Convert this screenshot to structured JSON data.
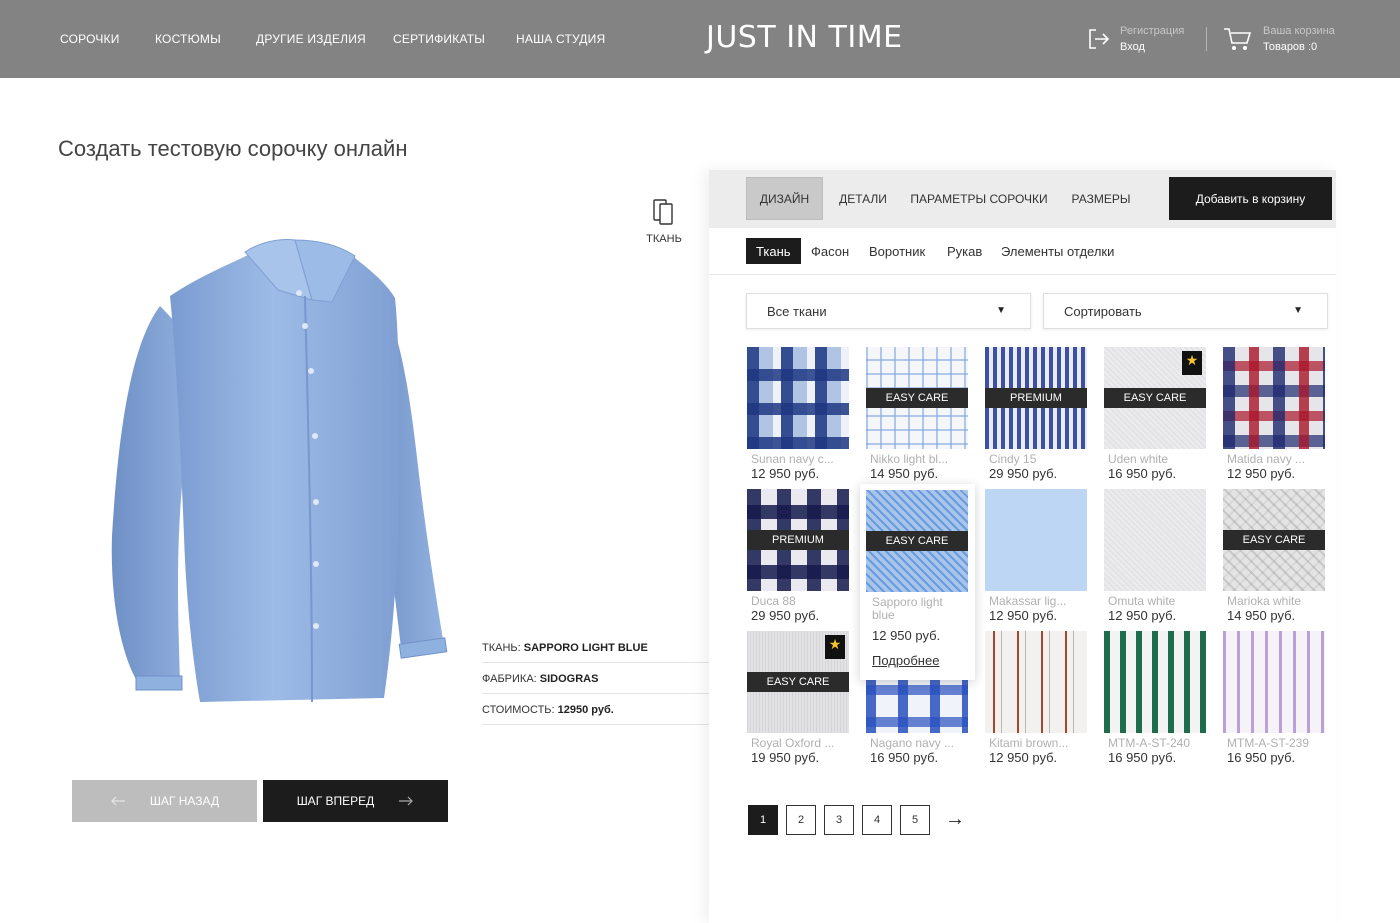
{
  "header": {
    "nav": [
      "СОРОЧКИ",
      "КОСТЮМЫ",
      "ДРУГИЕ ИЗДЕЛИЯ",
      "СЕРТИФИКАТЫ",
      "НАША СТУДИЯ"
    ],
    "logo": "JUST IN TIME",
    "register_label": "Регистрация",
    "login_label": "Вход",
    "cart_label": "Ваша корзина",
    "cart_count": "Товаров :0",
    "login_icon": "login-icon",
    "cart_icon": "cart-icon"
  },
  "page_title": "Создать тестовую сорочку онлайн",
  "fabric_control": {
    "label": "ТКАНЬ",
    "icon": "fabric-swatch-icon"
  },
  "info": {
    "fabric_label": "ТКАНЬ: ",
    "fabric_value": "SAPPORO LIGHT BLUE",
    "factory_label": "ФАБРИКА: ",
    "factory_value": "SIDOGRAS",
    "price_label": "СТОИМОСТЬ: ",
    "price_value": "12950 руб."
  },
  "steps": {
    "back": "ШАГ НАЗАД",
    "forward": "ШАГ ВПЕРЕД"
  },
  "tabs": {
    "items": [
      "ДИЗАЙН",
      "ДЕТАЛИ",
      "ПАРАМЕТРЫ СОРОЧКИ",
      "РАЗМЕРЫ"
    ],
    "active": "ДИЗАЙН",
    "add_to_cart": "Добавить в корзину"
  },
  "subtabs": {
    "items": [
      "Ткань",
      "Фасон",
      "Воротник",
      "Рукав",
      "Элементы отделки"
    ],
    "active": "Ткань"
  },
  "filters": {
    "fabrics": "Все ткани",
    "sort": "Сортировать"
  },
  "fabrics": [
    {
      "name": "Sunan navy c...",
      "price": "12 950 руб.",
      "badge": "",
      "star": false,
      "pattern": "check-navy"
    },
    {
      "name": "Nikko light bl...",
      "price": "14 950 руб.",
      "badge": "EASY CARE",
      "star": false,
      "pattern": "check-light"
    },
    {
      "name": "Cindy 15",
      "price": "29 950 руб.",
      "badge": "PREMIUM",
      "star": false,
      "pattern": "stripe-navy"
    },
    {
      "name": "Uden white",
      "price": "16 950 руб.",
      "badge": "EASY CARE",
      "star": true,
      "pattern": "white"
    },
    {
      "name": "Matida navy ...",
      "price": "12 950 руб.",
      "badge": "",
      "star": false,
      "pattern": "check-red"
    },
    {
      "name": "Duca 88",
      "price": "29 950 руб.",
      "badge": "PREMIUM",
      "star": false,
      "pattern": "check-dark"
    },
    {
      "name": "Sapporo light blue",
      "price": "12 950 руб.",
      "badge": "EASY CARE",
      "star": false,
      "pattern": "diag-blue"
    },
    {
      "name": "Makassar lig...",
      "price": "12 950 руб.",
      "badge": "",
      "star": false,
      "pattern": "plain-blue"
    },
    {
      "name": "Omuta white",
      "price": "12 950 руб.",
      "badge": "",
      "star": false,
      "pattern": "white"
    },
    {
      "name": "Marioka white",
      "price": "14 950 руб.",
      "badge": "EASY CARE",
      "star": false,
      "pattern": "herringbone"
    },
    {
      "name": "Royal Oxford ...",
      "price": "19 950 руб.",
      "badge": "EASY CARE",
      "star": true,
      "pattern": "oxford"
    },
    {
      "name": "Nagano navy ...",
      "price": "16 950 руб.",
      "badge": "",
      "star": false,
      "pattern": "check-blue"
    },
    {
      "name": "Kitami brown...",
      "price": "12 950 руб.",
      "badge": "",
      "star": false,
      "pattern": "stripe-brown"
    },
    {
      "name": "MTM-A-ST-240",
      "price": "16 950 руб.",
      "badge": "",
      "star": false,
      "pattern": "stripe-green"
    },
    {
      "name": "MTM-A-ST-239",
      "price": "16 950 руб.",
      "badge": "",
      "star": false,
      "pattern": "stripe-lilac"
    }
  ],
  "popup": {
    "more": "Подробнее"
  },
  "pagination": {
    "pages": [
      "1",
      "2",
      "3",
      "4",
      "5"
    ],
    "current": "1",
    "next_icon": "arrow-right-icon"
  },
  "colors": {
    "header_bg": "#838383",
    "dark": "#1c1c1c",
    "shirt": "#8fb1e0",
    "star": "#f4c430"
  }
}
